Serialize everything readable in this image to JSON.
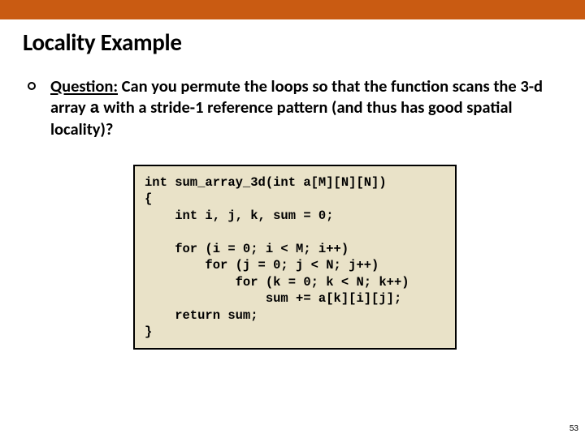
{
  "slide": {
    "title": "Locality Example",
    "bullet": {
      "question_label": "Question:",
      "lead": " Can you permute the loops so that the function scans the 3-d array ",
      "array_name": "a",
      "tail": " with a stride-1 reference pattern (and thus has good spatial locality)?"
    },
    "code": {
      "lines": [
        "int sum_array_3d(int a[M][N][N])",
        "{",
        "    int i, j, k, sum = 0;",
        "",
        "    for (i = 0; i < M; i++)",
        "        for (j = 0; j < N; j++)",
        "            for (k = 0; k < N; k++)",
        "                sum += a[k][i][j];",
        "    return sum;",
        "}"
      ]
    },
    "page_number": "53"
  }
}
